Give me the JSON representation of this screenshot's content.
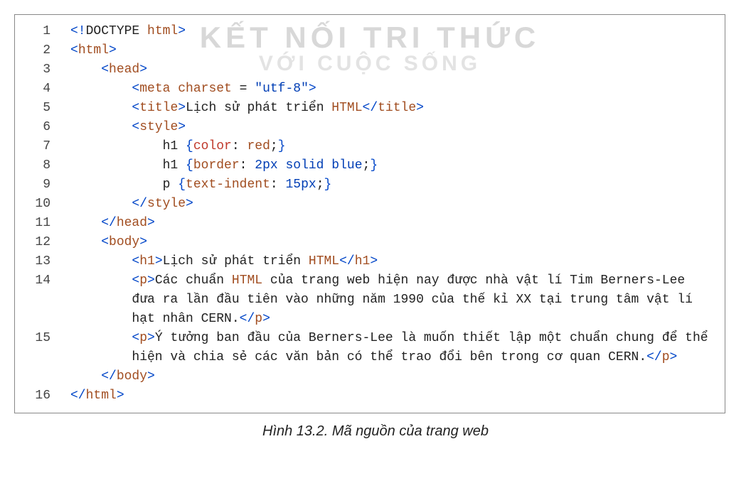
{
  "watermark": {
    "line1": "KẾT NỐI TRI THỨC",
    "line2": "VỚI CUỘC SỐNG"
  },
  "caption": "Hình 13.2. Mã nguồn của trang web",
  "lines": [
    {
      "n": "1",
      "indent": 0,
      "seg": [
        {
          "t": "<!",
          "c": "c-blue"
        },
        {
          "t": "DOCTYPE ",
          "c": "c-black"
        },
        {
          "t": "html",
          "c": "c-brown"
        },
        {
          "t": ">",
          "c": "c-blue"
        }
      ]
    },
    {
      "n": "2",
      "indent": 0,
      "seg": [
        {
          "t": "<",
          "c": "c-blue"
        },
        {
          "t": "html",
          "c": "c-brown"
        },
        {
          "t": ">",
          "c": "c-blue"
        }
      ]
    },
    {
      "n": "3",
      "indent": 1,
      "seg": [
        {
          "t": "<",
          "c": "c-blue"
        },
        {
          "t": "head",
          "c": "c-brown"
        },
        {
          "t": ">",
          "c": "c-blue"
        }
      ]
    },
    {
      "n": "4",
      "indent": 2,
      "seg": [
        {
          "t": "<",
          "c": "c-blue"
        },
        {
          "t": "meta ",
          "c": "c-brown"
        },
        {
          "t": "charset",
          "c": "c-brown"
        },
        {
          "t": " = ",
          "c": "c-black"
        },
        {
          "t": "\"utf-8\"",
          "c": "c-blue2"
        },
        {
          "t": ">",
          "c": "c-blue"
        }
      ]
    },
    {
      "n": "5",
      "indent": 2,
      "seg": [
        {
          "t": "<",
          "c": "c-blue"
        },
        {
          "t": "title",
          "c": "c-brown"
        },
        {
          "t": ">",
          "c": "c-blue"
        },
        {
          "t": "Lịch sử phát triển ",
          "c": "c-black"
        },
        {
          "t": "HTML",
          "c": "c-brown"
        },
        {
          "t": "</",
          "c": "c-blue"
        },
        {
          "t": "title",
          "c": "c-brown"
        },
        {
          "t": ">",
          "c": "c-blue"
        }
      ]
    },
    {
      "n": "6",
      "indent": 2,
      "seg": [
        {
          "t": "<",
          "c": "c-blue"
        },
        {
          "t": "style",
          "c": "c-brown"
        },
        {
          "t": ">",
          "c": "c-blue"
        }
      ]
    },
    {
      "n": "7",
      "indent": 3,
      "seg": [
        {
          "t": "h1 ",
          "c": "c-black"
        },
        {
          "t": "{",
          "c": "c-blue"
        },
        {
          "t": "color",
          "c": "c-red"
        },
        {
          "t": ": ",
          "c": "c-black"
        },
        {
          "t": "red",
          "c": "c-brown"
        },
        {
          "t": ";",
          "c": "c-black"
        },
        {
          "t": "}",
          "c": "c-blue"
        }
      ]
    },
    {
      "n": "8",
      "indent": 3,
      "seg": [
        {
          "t": "h1 ",
          "c": "c-black"
        },
        {
          "t": "{",
          "c": "c-blue"
        },
        {
          "t": "border",
          "c": "c-brown"
        },
        {
          "t": ": ",
          "c": "c-black"
        },
        {
          "t": "2px solid blue",
          "c": "c-blue2"
        },
        {
          "t": ";",
          "c": "c-black"
        },
        {
          "t": "}",
          "c": "c-blue"
        }
      ]
    },
    {
      "n": "9",
      "indent": 3,
      "seg": [
        {
          "t": "p ",
          "c": "c-black"
        },
        {
          "t": "{",
          "c": "c-blue"
        },
        {
          "t": "text-indent",
          "c": "c-brown"
        },
        {
          "t": ": ",
          "c": "c-black"
        },
        {
          "t": "15px",
          "c": "c-blue2"
        },
        {
          "t": ";",
          "c": "c-black"
        },
        {
          "t": "}",
          "c": "c-blue"
        }
      ]
    },
    {
      "n": "10",
      "indent": 2,
      "seg": [
        {
          "t": "</",
          "c": "c-blue"
        },
        {
          "t": "style",
          "c": "c-brown"
        },
        {
          "t": ">",
          "c": "c-blue"
        }
      ]
    },
    {
      "n": "11",
      "indent": 1,
      "seg": [
        {
          "t": "</",
          "c": "c-blue"
        },
        {
          "t": "head",
          "c": "c-brown"
        },
        {
          "t": ">",
          "c": "c-blue"
        }
      ]
    },
    {
      "n": "12",
      "indent": 1,
      "seg": [
        {
          "t": "<",
          "c": "c-blue"
        },
        {
          "t": "body",
          "c": "c-brown"
        },
        {
          "t": ">",
          "c": "c-blue"
        }
      ]
    },
    {
      "n": "13",
      "indent": 2,
      "seg": [
        {
          "t": "<",
          "c": "c-blue"
        },
        {
          "t": "h1",
          "c": "c-brown"
        },
        {
          "t": ">",
          "c": "c-blue"
        },
        {
          "t": "Lịch sử phát triển ",
          "c": "c-black"
        },
        {
          "t": "HTML",
          "c": "c-brown"
        },
        {
          "t": "</",
          "c": "c-blue"
        },
        {
          "t": "h1",
          "c": "c-brown"
        },
        {
          "t": ">",
          "c": "c-blue"
        }
      ]
    },
    {
      "n": "14",
      "indent": 2,
      "seg": [
        {
          "t": "<",
          "c": "c-blue"
        },
        {
          "t": "p",
          "c": "c-brown"
        },
        {
          "t": ">",
          "c": "c-blue"
        },
        {
          "t": "Các chuẩn ",
          "c": "c-black"
        },
        {
          "t": "HTML",
          "c": "c-brown"
        },
        {
          "t": " của trang web hiện nay được nhà vật lí Tim Berners-Lee đưa ra lần đầu tiên vào những năm 1990 của thế kỉ XX tại trung tâm vật lí hạt nhân CERN.",
          "c": "c-black"
        },
        {
          "t": "</",
          "c": "c-blue"
        },
        {
          "t": "p",
          "c": "c-brown"
        },
        {
          "t": ">",
          "c": "c-blue"
        }
      ]
    },
    {
      "n": "15",
      "indent": 2,
      "seg": [
        {
          "t": "<",
          "c": "c-blue"
        },
        {
          "t": "p",
          "c": "c-brown"
        },
        {
          "t": ">",
          "c": "c-blue"
        },
        {
          "t": "Ý tưởng ban đầu của Berners-Lee là muốn thiết lập một chuẩn chung để thể hiện và chia sẻ các văn bản có thể trao đổi bên trong cơ quan CERN.",
          "c": "c-black"
        },
        {
          "t": "</",
          "c": "c-blue"
        },
        {
          "t": "p",
          "c": "c-brown"
        },
        {
          "t": ">",
          "c": "c-blue"
        }
      ]
    },
    {
      "n": "",
      "indent": 1,
      "seg": [
        {
          "t": "</",
          "c": "c-blue"
        },
        {
          "t": "body",
          "c": "c-brown"
        },
        {
          "t": ">",
          "c": "c-blue"
        }
      ]
    },
    {
      "n": "16",
      "indent": 0,
      "seg": [
        {
          "t": "</",
          "c": "c-blue"
        },
        {
          "t": "html",
          "c": "c-brown"
        },
        {
          "t": ">",
          "c": "c-blue"
        }
      ]
    }
  ]
}
